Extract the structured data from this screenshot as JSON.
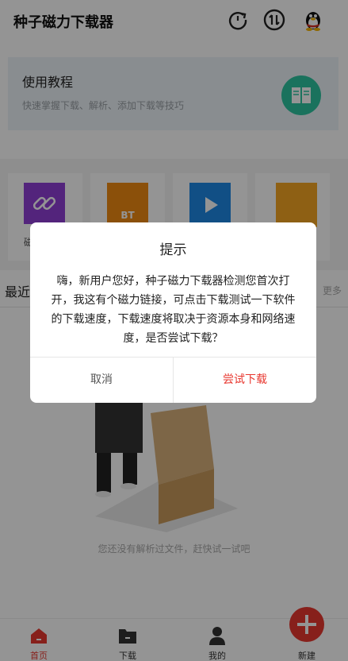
{
  "app": {
    "title": "种子磁力下载器"
  },
  "header_icons": [
    "refresh-icon",
    "sort-icon",
    "qq-penguin-icon"
  ],
  "tutorial": {
    "title": "使用教程",
    "subtitle": "快速掌握下载、解析、添加下载等技巧"
  },
  "quick_actions": [
    {
      "icon": "link-icon",
      "label": "磁"
    },
    {
      "icon": "bt-file-icon",
      "label": "BT"
    },
    {
      "icon": "video-icon",
      "label": ""
    },
    {
      "icon": "folder-icon",
      "label": ""
    }
  ],
  "recent": {
    "label": "最近",
    "more": "更多"
  },
  "empty_state": {
    "text": "您还没有解析过文件，赶快试一试吧"
  },
  "bottom_nav": [
    {
      "label": "首页",
      "icon": "home-icon",
      "active": true
    },
    {
      "label": "下载",
      "icon": "download-folder-icon",
      "active": false
    },
    {
      "label": "我的",
      "icon": "user-icon",
      "active": false
    },
    {
      "label": "新建",
      "icon": "plus-icon",
      "active": false
    }
  ],
  "dialog": {
    "title": "提示",
    "message": "嗨，新用户您好，种子磁力下载器检测您首次打开，我这有个磁力链接，可点击下载测试一下软件的下载速度，下载速度将取决于资源本身和网络速度，是否尝试下载？",
    "cancel": "取消",
    "confirm": "尝试下载"
  },
  "colors": {
    "accent": "#e8372f",
    "tutorial_icon": "#2ec4a1",
    "overlay": "rgba(0,0,0,0.42)"
  }
}
